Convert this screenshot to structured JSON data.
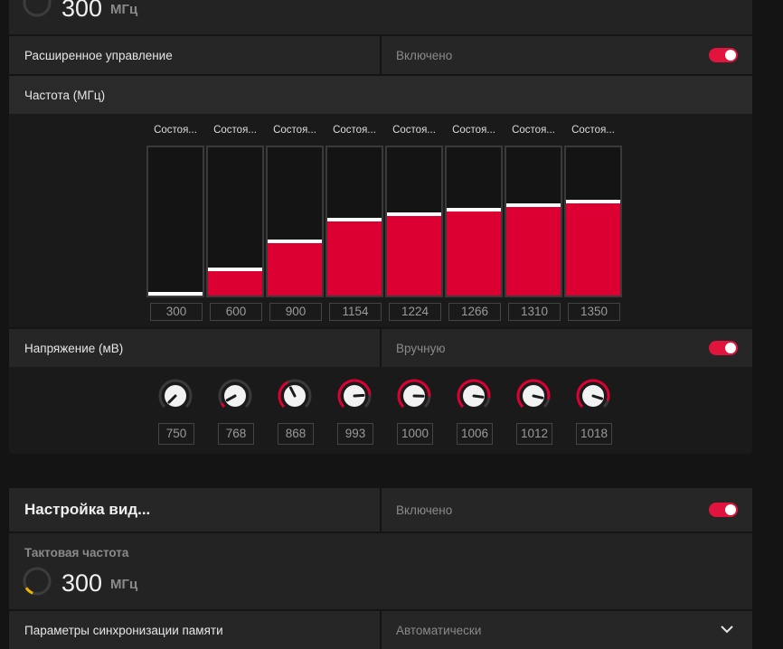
{
  "top_clock": {
    "value": "300",
    "unit": "МГц"
  },
  "advanced_control": {
    "label": "Расширенное управление",
    "state": "Включено",
    "enabled": true
  },
  "frequency_section": {
    "label": "Частота (МГц)",
    "states": [
      {
        "label": "Состоя...",
        "value": "300",
        "level": 0.0
      },
      {
        "label": "Состоя...",
        "value": "600",
        "level": 0.17
      },
      {
        "label": "Состоя...",
        "value": "900",
        "level": 0.36
      },
      {
        "label": "Состоя...",
        "value": "1154",
        "level": 0.51
      },
      {
        "label": "Состоя...",
        "value": "1224",
        "level": 0.55
      },
      {
        "label": "Состоя...",
        "value": "1266",
        "level": 0.58
      },
      {
        "label": "Состоя...",
        "value": "1310",
        "level": 0.61
      },
      {
        "label": "Состоя...",
        "value": "1350",
        "level": 0.64
      }
    ]
  },
  "voltage_section": {
    "label": "Напряжение (мВ)",
    "mode": "Вручную",
    "enabled": true,
    "values": [
      {
        "value": "750",
        "level": 0.0
      },
      {
        "value": "768",
        "level": 0.06
      },
      {
        "value": "868",
        "level": 0.4
      },
      {
        "value": "993",
        "level": 0.82
      },
      {
        "value": "1000",
        "level": 0.84
      },
      {
        "value": "1006",
        "level": 0.86
      },
      {
        "value": "1012",
        "level": 0.88
      },
      {
        "value": "1018",
        "level": 0.9
      }
    ]
  },
  "video_tuning": {
    "label": "Настройка вид...",
    "state": "Включено",
    "enabled": true
  },
  "clock_speed": {
    "label": "Тактовая частота",
    "value": "300",
    "unit": "МГц",
    "level": 0.12
  },
  "memory_timing": {
    "label": "Параметры синхронизации памяти",
    "value": "Автоматически"
  },
  "colors": {
    "accent": "#dc0032",
    "gauge_accent": "#f0b400"
  }
}
